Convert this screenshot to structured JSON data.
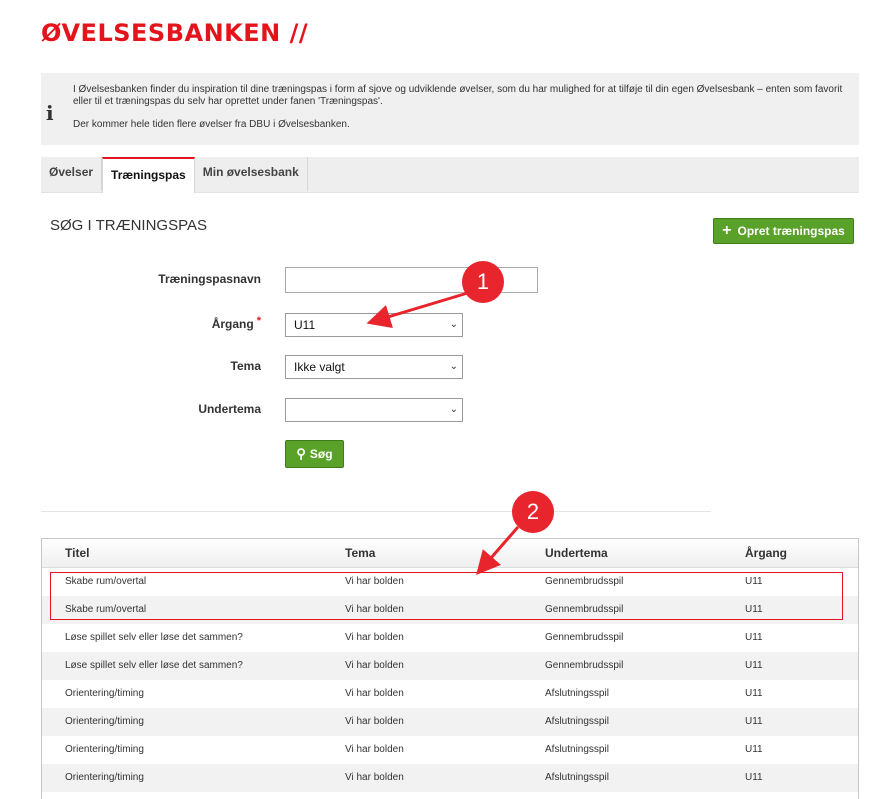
{
  "header": {
    "title": "ØVELSESBANKEN //"
  },
  "info": {
    "icon": "info-icon",
    "paragraph1": "I Øvelsesbanken finder du inspiration til dine træningspas i form af sjove og udviklende øvelser, som du har mulighed for at tilføje til din egen Øvelsesbank – enten som favorit eller til et træningspas du selv har oprettet under fanen 'Træningspas'.",
    "paragraph2": "Der kommer hele tiden flere øvelser fra DBU i Øvelsesbanken."
  },
  "tabs": [
    {
      "label": "Øvelser",
      "active": false
    },
    {
      "label": "Træningspas",
      "active": true
    },
    {
      "label": "Min øvelsesbank",
      "active": false
    }
  ],
  "section": {
    "title": "SØG I TRÆNINGSPAS"
  },
  "create_button": {
    "label": "Opret træningspas",
    "icon": "plus-icon"
  },
  "form": {
    "name_label": "Træningspasnavn",
    "name_value": "",
    "argang_label": "Årgang",
    "argang_required": "*",
    "argang_value": "U11",
    "tema_label": "Tema",
    "tema_value": "Ikke valgt",
    "undertema_label": "Undertema",
    "undertema_value": "",
    "search_label": "Søg"
  },
  "table": {
    "headers": [
      "Titel",
      "Tema",
      "Undertema",
      "Årgang"
    ],
    "rows": [
      [
        "Skabe rum/overtal",
        "Vi har bolden",
        "Gennembrudsspil",
        "U11"
      ],
      [
        "Skabe rum/overtal",
        "Vi har bolden",
        "Gennembrudsspil",
        "U11"
      ],
      [
        "Løse spillet selv eller løse det sammen?",
        "Vi har bolden",
        "Gennembrudsspil",
        "U11"
      ],
      [
        "Løse spillet selv eller løse det sammen?",
        "Vi har bolden",
        "Gennembrudsspil",
        "U11"
      ],
      [
        "Orientering/timing",
        "Vi har bolden",
        "Afslutningsspil",
        "U11"
      ],
      [
        "Orientering/timing",
        "Vi har bolden",
        "Afslutningsspil",
        "U11"
      ],
      [
        "Orientering/timing",
        "Vi har bolden",
        "Afslutningsspil",
        "U11"
      ],
      [
        "Orientering/timing",
        "Vi har bolden",
        "Afslutningsspil",
        "U11"
      ]
    ]
  },
  "annotations": {
    "badge1": "1",
    "badge2": "2",
    "color": "#e8242d"
  },
  "colors": {
    "brand_red": "#e3141b",
    "button_green": "#5aa12a"
  }
}
